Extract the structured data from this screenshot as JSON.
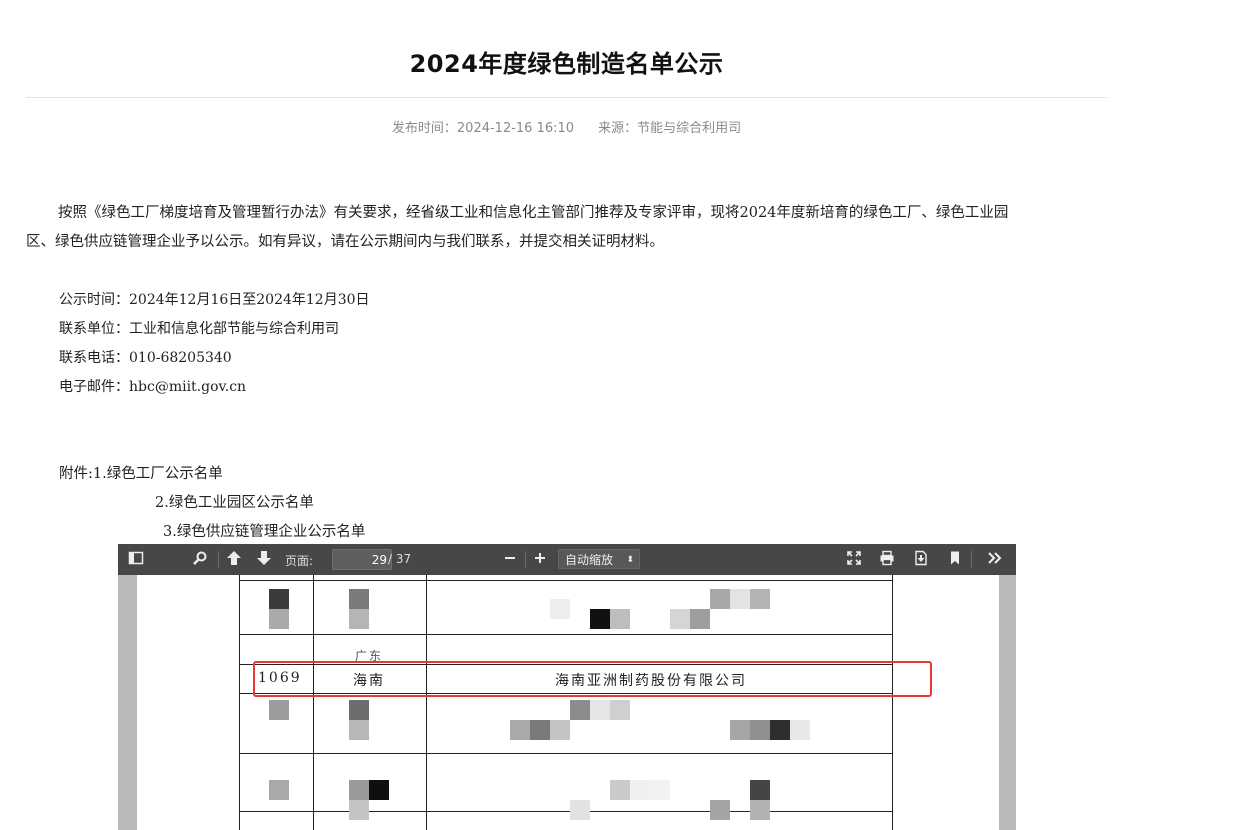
{
  "article": {
    "title": "2024年度绿色制造名单公示",
    "publish_time": "发布时间：2024-12-16 16:10",
    "source": "来源：节能与综合利用司",
    "paragraph_line1": "按照《绿色工厂梯度培育及管理暂行办法》有关要求，经省级工业和信息化主管部门推荐及专家评审，现将2024年度新培育的绿色工厂、绿色工业园",
    "paragraph_line2": "区、绿色供应链管理企业予以公示。如有异议，请在公示期间内与我们联系，并提交相关证明材料。",
    "notice_period": "公示时间：2024年12月16日至2024年12月30日",
    "contact_unit": "联系单位：工业和信息化部节能与综合利用司",
    "contact_phone": "联系电话：010-68205340",
    "email": "电子邮件：hbc@miit.gov.cn",
    "attachments": [
      "附件:1.绿色工厂公示名单",
      "2.绿色工业园区公示名单",
      "3.绿色供应链管理企业公示名单"
    ]
  },
  "pdf_viewer": {
    "page_label": "页面:",
    "current_page": "29",
    "total_pages": "/ 37",
    "zoom": "自动缩放",
    "icons": [
      "sidebar-toggle-icon",
      "search-icon",
      "previous-page-icon",
      "next-page-icon",
      "zoom-out-icon",
      "zoom-in-icon",
      "presentation-mode-icon",
      "print-icon",
      "download-icon",
      "bookmark-icon",
      "tools-icon"
    ],
    "highlighted_row": {
      "number": "1069",
      "region": "海南",
      "company": "海南亚洲制药股份有限公司"
    },
    "partial_region_label": "广东",
    "highlight_color": "#e53935"
  }
}
